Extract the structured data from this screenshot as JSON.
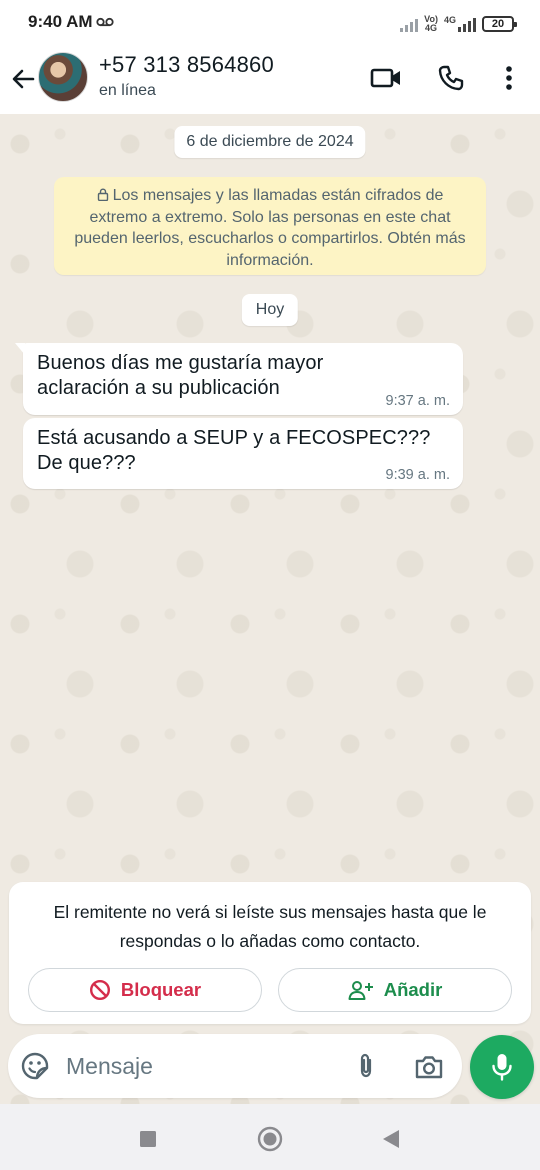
{
  "status_bar": {
    "time": "9:40 AM",
    "net_top": "Vo)",
    "net_bottom": "4G",
    "net2": "4G",
    "battery": "20"
  },
  "header": {
    "contact_name": "+57 313 8564860",
    "contact_status": "en línea",
    "icons": [
      "back-arrow-icon",
      "video-call-icon",
      "voice-call-icon",
      "more-options-icon"
    ]
  },
  "chat": {
    "date_chip": "6 de diciembre de 2024",
    "encryption_notice": "Los mensajes y las llamadas están cifrados de extremo a extremo. Solo las personas en este chat pueden leerlos, escucharlos o compartirlos. Obtén más información.",
    "today_chip": "Hoy",
    "messages": [
      {
        "text": "Buenos días me gustaría mayor aclaración a su publicación",
        "time": "9:37 a. m."
      },
      {
        "text": "Está acusando a SEUP y a FECOSPEC??? De que???",
        "time": "9:39 a. m."
      }
    ]
  },
  "unknown_contact": {
    "notice": "El remitente no verá si leíste sus mensajes hasta que le respondas o lo añadas como contacto.",
    "block_label": "Bloquear",
    "add_label": "Añadir"
  },
  "composer": {
    "placeholder": "Mensaje"
  },
  "colors": {
    "accent_green": "#1daa61",
    "block_red": "#d42d4b",
    "add_green": "#1d8d4d",
    "chat_bg": "#efeae2",
    "notice_yellow": "#fdf4c5"
  }
}
